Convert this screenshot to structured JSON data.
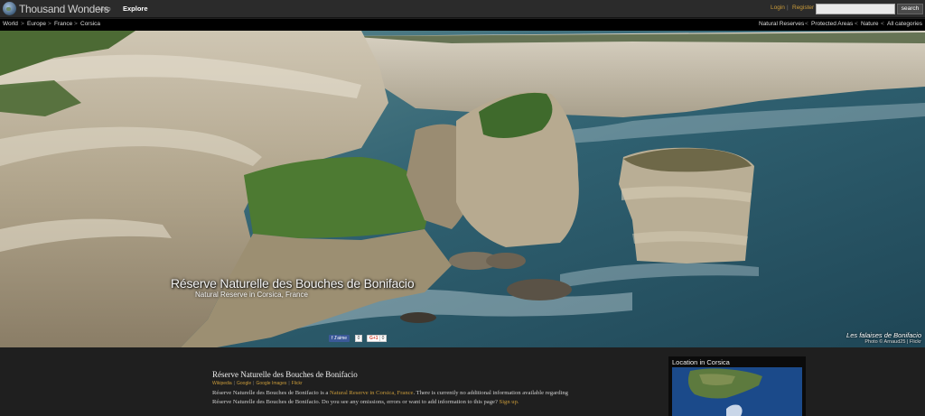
{
  "header": {
    "logo_text": "Thousand Wonders",
    "nav": [
      "Map",
      "Explore"
    ],
    "login_label": "Login",
    "separator": "|",
    "register_label": "Register",
    "search_placeholder": "",
    "search_button": "search"
  },
  "breadcrumb": {
    "items": [
      "World",
      "Europe",
      "France",
      "Corsica"
    ],
    "separator": ">"
  },
  "categories": {
    "items": [
      "Natural Reserves",
      "Protected Areas",
      "Nature",
      "All categories"
    ],
    "separator": "<"
  },
  "hero": {
    "title": "Réserve Naturelle des Bouches de Bonifacio",
    "subtitle": "Natural Reserve in Corsica, France",
    "photo_title": "Les falaises de Bonifacio",
    "photo_credit": "Photo © Arnaud25 | Flickr"
  },
  "social": {
    "facebook_label": "f J'aime",
    "facebook_count": "0",
    "gplus_label": "G+1",
    "gplus_count": "0"
  },
  "content": {
    "title": "Réserve Naturelle des Bouches de Bonifacio",
    "links": [
      "Wikipedia",
      "Google",
      "Google Images",
      "Flickr"
    ],
    "desc_part1": "Réserve Naturelle des Bouches de Bonifacio is a",
    "desc_link": "Natural Reserve in Corsica, France",
    "desc_part2": ". There is currently no additional information available regarding Réserve Naturelle des Bouches de Bonifacio. Do you see any omissions, errors or want to add information to this page?",
    "signup": "Sign up."
  },
  "sidebar": {
    "map_title": "Location in Corsica"
  },
  "colors": {
    "accent": "#c89a3a",
    "background": "#1f1f1f",
    "topbar": "#2b2b2b"
  }
}
